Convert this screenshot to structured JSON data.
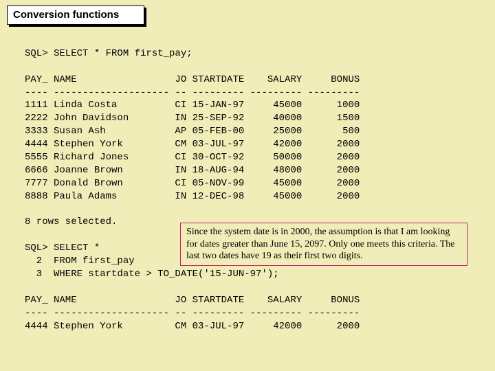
{
  "title": "Conversion functions",
  "query1": "SQL> SELECT * FROM first_pay;",
  "header": "PAY_ NAME                 JO STARTDATE    SALARY     BONUS",
  "divider": "---- -------------------- -- --------- --------- ---------",
  "rows1": [
    "1111 Linda Costa          CI 15-JAN-97     45000      1000",
    "2222 John Davidson        IN 25-SEP-92     40000      1500",
    "3333 Susan Ash            AP 05-FEB-00     25000       500",
    "4444 Stephen York         CM 03-JUL-97     42000      2000",
    "5555 Richard Jones        CI 30-OCT-92     50000      2000",
    "6666 Joanne Brown         IN 18-AUG-94     48000      2000",
    "7777 Donald Brown         CI 05-NOV-99     45000      2000",
    "8888 Paula Adams          IN 12-DEC-98     45000      2000"
  ],
  "rows_selected": "8 rows selected.",
  "query2_l1": "SQL> SELECT *",
  "query2_l2": "  2  FROM first_pay",
  "query2_l3": "  3  WHERE startdate > TO_DATE('15-JUN-97');",
  "rows2": [
    "4444 Stephen York         CM 03-JUL-97     42000      2000"
  ],
  "note": "Since the system date is in 2000, the assumption is that I am looking for dates greater than June 15, 2097.  Only one meets this criteria.  The last two dates have 19 as their first two digits.",
  "chart_data": {
    "type": "table",
    "title": "first_pay",
    "columns": [
      "PAY_",
      "NAME",
      "JO",
      "STARTDATE",
      "SALARY",
      "BONUS"
    ],
    "rows": [
      [
        1111,
        "Linda Costa",
        "CI",
        "15-JAN-97",
        45000,
        1000
      ],
      [
        2222,
        "John Davidson",
        "IN",
        "25-SEP-92",
        40000,
        1500
      ],
      [
        3333,
        "Susan Ash",
        "AP",
        "05-FEB-00",
        25000,
        500
      ],
      [
        4444,
        "Stephen York",
        "CM",
        "03-JUL-97",
        42000,
        2000
      ],
      [
        5555,
        "Richard Jones",
        "CI",
        "30-OCT-92",
        50000,
        2000
      ],
      [
        6666,
        "Joanne Brown",
        "IN",
        "18-AUG-94",
        48000,
        2000
      ],
      [
        7777,
        "Donald Brown",
        "CI",
        "05-NOV-99",
        45000,
        2000
      ],
      [
        8888,
        "Paula Adams",
        "IN",
        "12-DEC-98",
        45000,
        2000
      ]
    ],
    "filtered_rows": [
      [
        4444,
        "Stephen York",
        "CM",
        "03-JUL-97",
        42000,
        2000
      ]
    ]
  }
}
